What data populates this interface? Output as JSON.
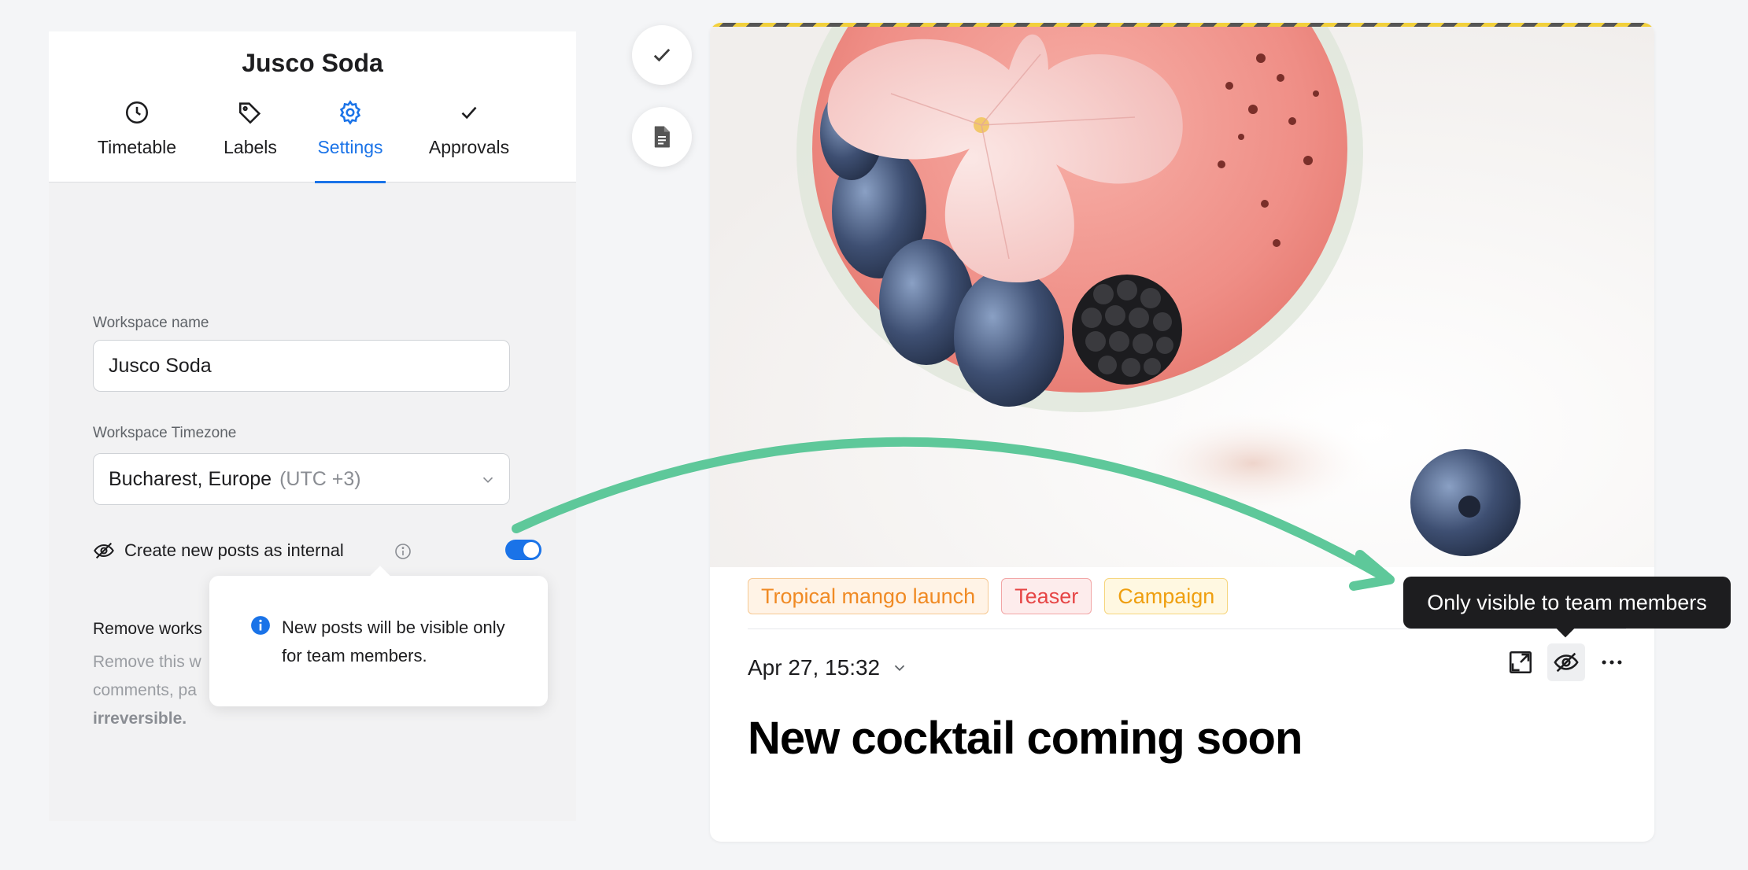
{
  "workspace": {
    "title": "Jusco Soda",
    "tabs": [
      {
        "label": "Timetable",
        "icon": "clock-icon"
      },
      {
        "label": "Labels",
        "icon": "tag-icon"
      },
      {
        "label": "Settings",
        "icon": "gear-icon",
        "active": true
      },
      {
        "label": "Approvals",
        "icon": "check-icon"
      }
    ]
  },
  "settings": {
    "name_label": "Workspace name",
    "name_value": "Jusco Soda",
    "timezone_label": "Workspace Timezone",
    "timezone_value": "Bucharest, Europe",
    "timezone_offset": "(UTC +3)",
    "internal_label": "Create new posts as internal",
    "internal_enabled": true,
    "remove_title": "Remove works",
    "remove_desc_1": "Remove this w",
    "remove_desc_2": "comments, pa",
    "remove_desc_3": "irreversible."
  },
  "popover": {
    "text": "New posts will be visible only for team members."
  },
  "side_buttons": [
    {
      "icon": "check-icon"
    },
    {
      "icon": "document-icon"
    }
  ],
  "post": {
    "labels": [
      {
        "text": "Tropical mango launch",
        "color": "#f08a24"
      },
      {
        "text": "Teaser",
        "color": "#e64545"
      },
      {
        "text": "Campaign",
        "color": "#ef9f0f"
      }
    ],
    "date": "Apr 27, 15:32",
    "title": "New cocktail coming soon",
    "tooltip": "Only visible to team members"
  },
  "colors": {
    "accent": "#1a73e8",
    "arrow": "#5ec89a"
  }
}
